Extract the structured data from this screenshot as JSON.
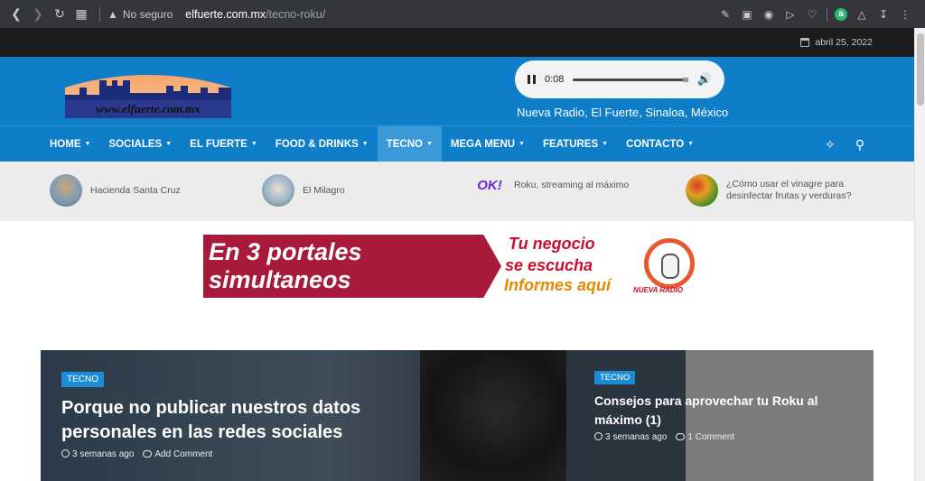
{
  "browser": {
    "security_label": "No seguro",
    "url_host": "elfuerte.com.mx",
    "url_path": "/tecno-roku/"
  },
  "topbar": {
    "date": "abril 25, 2022"
  },
  "header": {
    "logo_text": "www.elfuerte.com.mx",
    "player_time": "0:08",
    "tagline": "Nueva Radio, El Fuerte, Sinaloa, México"
  },
  "menu": {
    "items": [
      {
        "label": "HOME"
      },
      {
        "label": "SOCIALES"
      },
      {
        "label": "EL FUERTE"
      },
      {
        "label": "FOOD & DRINKS"
      },
      {
        "label": "TECNO"
      },
      {
        "label": "MEGA MENU"
      },
      {
        "label": "FEATURES"
      },
      {
        "label": "CONTACTO"
      }
    ],
    "active": "TECNO"
  },
  "ticker": [
    {
      "title": "Hacienda Santa Cruz"
    },
    {
      "title": "El Milagro"
    },
    {
      "title": "Roku, streaming al máximo",
      "thumb_text": "OK!"
    },
    {
      "title": "¿Cómo usar el vinagre para desinfectar frutas y verduras?"
    }
  ],
  "ad": {
    "left_text": "En 3 portales simultaneos",
    "line1": "Tu negocio",
    "line2": "se escucha",
    "line3": "Informes aquí",
    "brand": "NUEVA RADIO"
  },
  "featured": {
    "main": {
      "category": "TECNO",
      "title": "Porque no publicar nuestros datos personales en las redes sociales",
      "date": "3 semanas ago",
      "comments": "Add Comment"
    },
    "side": {
      "category": "TECNO",
      "title": "Consejos para aprovechar tu Roku al máximo (1)",
      "date": "3 semanas ago",
      "comments": "1 Comment"
    }
  },
  "colors": {
    "brand_blue": "#0f7ec8",
    "category_blue": "#1d8cd6",
    "ad_red": "#a8193a"
  }
}
